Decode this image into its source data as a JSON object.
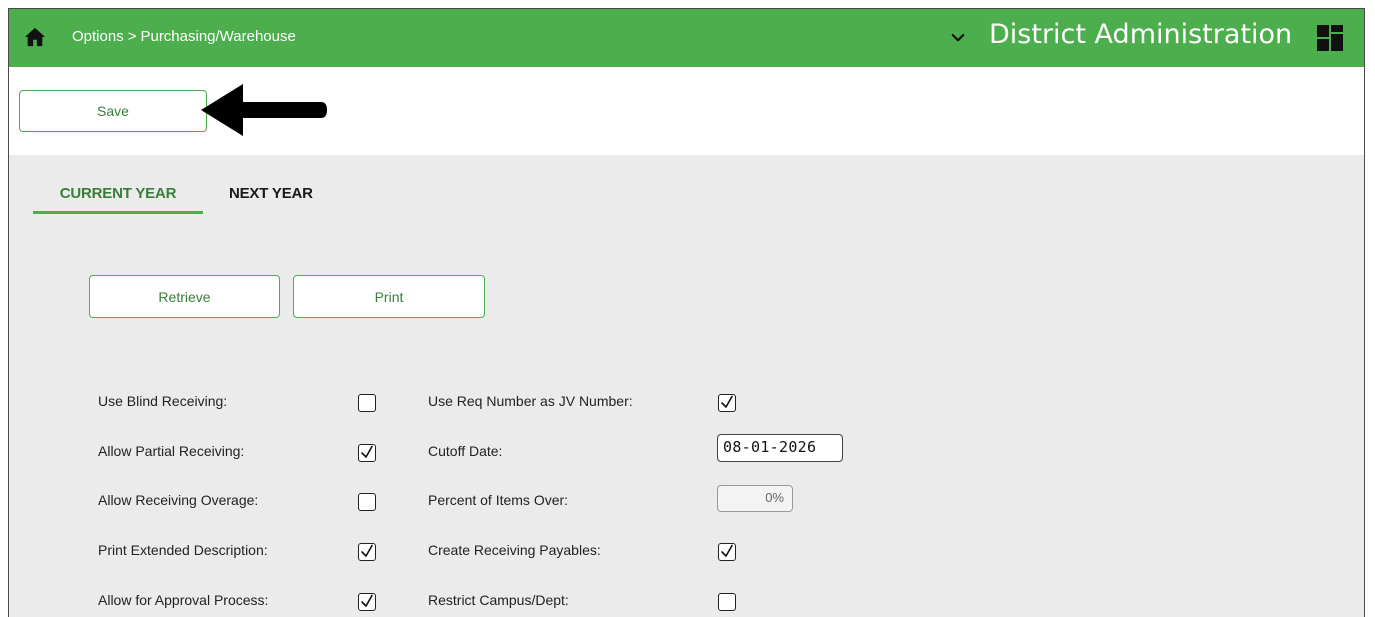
{
  "header": {
    "breadcrumb": [
      "Options",
      ">",
      "Purchasing/Warehouse"
    ],
    "app_title": "District Administration",
    "bar_color": "#4cae4c"
  },
  "toolbar": {
    "save_label": "Save"
  },
  "tabs": [
    {
      "label": "CURRENT YEAR",
      "active": true
    },
    {
      "label": "NEXT YEAR",
      "active": false
    }
  ],
  "actions": {
    "retrieve_label": "Retrieve",
    "print_label": "Print"
  },
  "left_fields": [
    {
      "label": "Use Blind Receiving:",
      "checked": false
    },
    {
      "label": "Allow Partial Receiving:",
      "checked": true
    },
    {
      "label": "Allow Receiving Overage:",
      "checked": false
    },
    {
      "label": "Print Extended Description:",
      "checked": true
    },
    {
      "label": "Allow for Approval Process:",
      "checked": true
    }
  ],
  "right_fields": [
    {
      "label": "Use Req Number as JV Number:",
      "checked": true
    },
    {
      "label": "Cutoff Date:",
      "value": "08-01-2026"
    },
    {
      "label": "Percent of Items Over:",
      "value": "0%"
    },
    {
      "label": "Create Receiving Payables:",
      "checked": true
    },
    {
      "label": "Restrict Campus/Dept:",
      "checked": false
    }
  ],
  "icons": {
    "home": "home-icon",
    "chevron": "chevron-down-icon",
    "apps": "grid-icon",
    "annotation": "arrow-left-icon"
  }
}
